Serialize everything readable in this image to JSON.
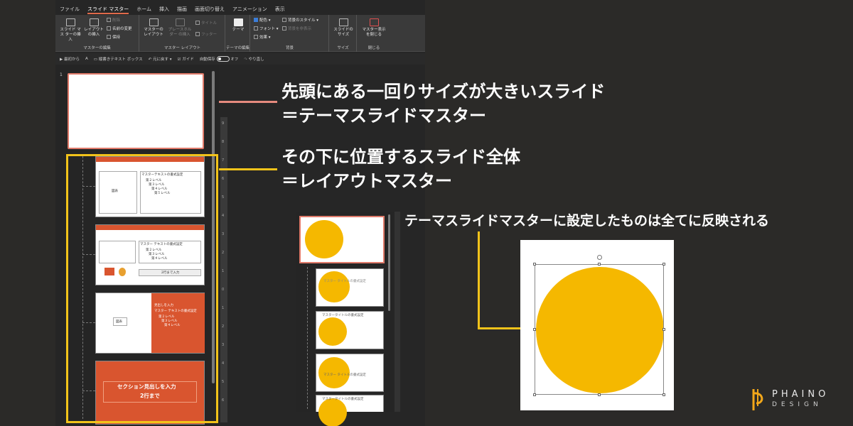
{
  "ribbon": {
    "tabs": [
      "ファイル",
      "スライド マスター",
      "ホーム",
      "挿入",
      "描画",
      "画面切り替え",
      "アニメーション",
      "表示"
    ],
    "active_tab": "スライド マスター",
    "groups": {
      "master_edit": {
        "label": "マスターの編集",
        "insert_master": "スライド マス ターの挿入",
        "insert_layout": "レイアウト の挿入",
        "delete": "削除",
        "rename": "名前の変更",
        "preserve": "保持"
      },
      "master_layout": {
        "label": "マスター レイアウト",
        "master_layout_btn": "マスターの レイアウト",
        "insert_placeholder": "プレースホルダー の挿入",
        "title": "タイトル",
        "footer": "フッター"
      },
      "edit_theme": {
        "label": "テーマの編集",
        "theme": "テーマ"
      },
      "background": {
        "label": "背景",
        "colors": "配色",
        "fonts": "フォント",
        "effects": "効果",
        "bg_styles": "背景のスタイル",
        "hide_bg": "背景を非表示"
      },
      "size": {
        "label": "サイズ",
        "slide_size": "スライドの サイズ"
      },
      "close": {
        "label": "閉じる",
        "close_master": "マスター表示 を閉じる"
      }
    }
  },
  "qat": {
    "from_start": "最初から",
    "vertical_textbox": "縦書きテキスト ボックス",
    "undo": "元に戻す",
    "guide": "ガイド",
    "autosave": "自動保存",
    "autosave_state": "オフ",
    "redo": "やり直し"
  },
  "thumbs": {
    "slide_number": "1",
    "layout1": {
      "title": "マスターテキストの書式設定",
      "levels": [
        "第２レベル",
        "第３レベル",
        "第４レベル",
        "第５レベル"
      ],
      "icon_label": "図表"
    },
    "layout2": {
      "title": "マスター テキストの書式設定",
      "levels": [
        "第２レベル",
        "第３レベル",
        "第４レベル"
      ],
      "button": "2行まで入力"
    },
    "layout3": {
      "heading": "見出しを入力",
      "title": "マスター テキストの書式設定",
      "levels": [
        "第２レベル",
        "第３レベル",
        "第４レベル"
      ],
      "icon_label": "図表"
    },
    "layout4": {
      "title": "セクション見出しを入力",
      "subtitle": "2行まで"
    }
  },
  "ruler_numbers": [
    "9",
    "8",
    "7",
    "6",
    "5",
    "4",
    "3",
    "2",
    "1",
    "0",
    "1",
    "2",
    "3",
    "4",
    "5",
    "6"
  ],
  "annotations": {
    "theme_master_line1": "先頭にある一回りサイズが大きいスライド",
    "theme_master_line2": "＝テーマスライドマスター",
    "layout_master_line1": "その下に位置するスライド全体",
    "layout_master_line2": "＝レイアウトマスター",
    "reflect": "テーマスライドマスターに設定したものは全てに反映される"
  },
  "mini_thumbs": {
    "title_text": "マスター タイトルの書式設定",
    "title_text2": "マスタータイトルの書式設定"
  },
  "logo": {
    "top": "PHAINO",
    "bottom": "DESIGN"
  },
  "colors": {
    "accent_orange": "#d9552f",
    "circle_yellow": "#f5b800",
    "highlight_yellow": "#f2c31a",
    "master_border": "#e07a6a"
  }
}
